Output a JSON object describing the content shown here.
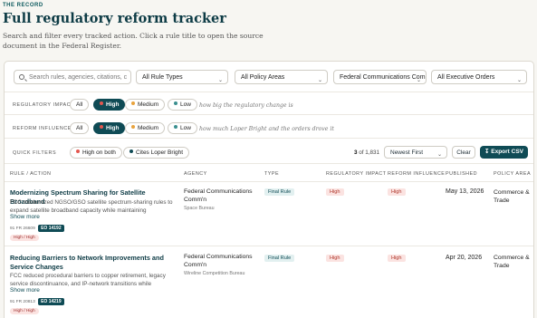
{
  "header": {
    "eyebrow": "THE RECORD",
    "title": "Full regulatory reform tracker",
    "subtitle": "Search and filter every tracked action. Click a rule title to open the source document in the Federal Register."
  },
  "filters": {
    "search_placeholder": "Search rules, agencies, citations, c",
    "rule_types": "All Rule Types",
    "policy_areas": "All Policy Areas",
    "agency": "Federal Communications Com",
    "executive_orders": "All Executive Orders"
  },
  "impact": {
    "label": "REGULATORY IMPACT",
    "options": [
      "All",
      "High",
      "Medium",
      "Low"
    ],
    "hint": "how big the regulatory change is"
  },
  "influence": {
    "label": "REFORM INFLUENCE",
    "options": [
      "All",
      "High",
      "Medium",
      "Low"
    ],
    "hint": "how much Loper Bright and the orders drove it"
  },
  "quick": {
    "label": "QUICK FILTERS",
    "options": [
      "High on both",
      "Cites Loper Bright"
    ]
  },
  "results": {
    "shown": "3",
    "total_text": "of 1,831",
    "sort": "Newest First",
    "clear": "Clear",
    "export": "Export CSV"
  },
  "columns": [
    "RULE / ACTION",
    "AGENCY",
    "TYPE",
    "REGULATORY IMPACT",
    "REFORM INFLUENCE",
    "PUBLISHED",
    "POLICY AREA"
  ],
  "rows": [
    {
      "title": "Modernizing Spectrum Sharing for Satellite Broadband",
      "desc": "FCC modernized NGSO/GSO satellite spectrum-sharing rules to expand satellite broadband capacity while maintaining technical...",
      "show_more": "Show more",
      "citation": "91 FR 26609",
      "eo": "EO 14192",
      "tag": "High / High",
      "agency": "Federal Communications Comm'n",
      "bureau": "Space Bureau",
      "type": "Final Rule",
      "impact": "High",
      "influence": "High",
      "published": "May 13, 2026",
      "area": "Commerce & Trade"
    },
    {
      "title": "Reducing Barriers to Network Improvements and Service Changes",
      "desc": "FCC reduced procedural barriers to copper retirement, legacy service discontinuance, and IP-network transitions while retainin...",
      "show_more": "Show more",
      "citation": "91 FR 20813",
      "eo": "EO 14219",
      "tag": "High / High",
      "agency": "Federal Communications Comm'n",
      "bureau": "Wireline Competition Bureau",
      "type": "Final Rule",
      "impact": "High",
      "influence": "High",
      "published": "Apr 20, 2026",
      "area": "Commerce & Trade"
    }
  ],
  "colors": {
    "accent": "#0f4b55",
    "high": "#d9534f",
    "medium": "#e8a33d",
    "low": "#3a8f8f"
  }
}
